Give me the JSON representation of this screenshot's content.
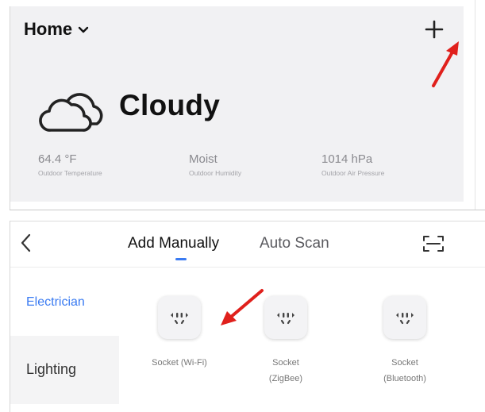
{
  "home": {
    "title": "Home",
    "add_icon": "plus-icon"
  },
  "weather": {
    "icon": "cloud-icon",
    "condition": "Cloudy",
    "stats": [
      {
        "value": "64.4 °F",
        "label": "Outdoor Temperature"
      },
      {
        "value": "Moist",
        "label": "Outdoor Humidity"
      },
      {
        "value": "1014 hPa",
        "label": "Outdoor Air Pressure"
      }
    ]
  },
  "add_device": {
    "back_icon": "chevron-left-icon",
    "tabs": [
      {
        "label": "Add Manually",
        "active": true
      },
      {
        "label": "Auto Scan",
        "active": false
      }
    ],
    "scan_icon": "scan-icon",
    "categories": [
      {
        "label": "Electrician",
        "active": true
      },
      {
        "label": "Lighting",
        "active": false
      }
    ],
    "devices": [
      {
        "name": "Socket (Wi-Fi)",
        "icon": "socket-icon"
      },
      {
        "name": "Socket (ZigBee)",
        "icon": "socket-icon"
      },
      {
        "name": "Socket (Bluetooth)",
        "icon": "socket-icon"
      }
    ]
  },
  "colors": {
    "accent": "#3a7bf2",
    "annotation_arrow": "#e0201c",
    "panel_bg": "#f1f1f3"
  }
}
